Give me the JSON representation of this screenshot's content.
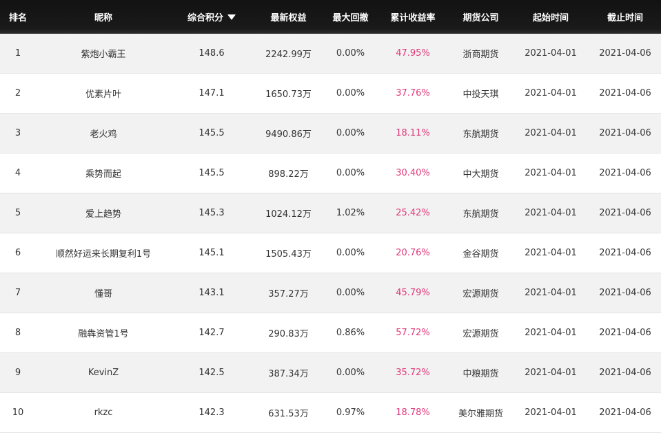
{
  "table": {
    "headers": {
      "rank": "排名",
      "nickname": "昵称",
      "score": "综合积分",
      "equity": "最新权益",
      "drawdown": "最大回撤",
      "yield": "累计收益率",
      "company": "期货公司",
      "start": "起始时间",
      "end": "截止时间"
    },
    "sort_icon": "caret-down-icon",
    "yield_color": "#e2367a",
    "rows": [
      {
        "rank": "1",
        "nickname": "紫炮小霸王",
        "score": "148.6",
        "equity": "2242.99万",
        "drawdown": "0.00%",
        "yield": "47.95%",
        "company": "浙商期货",
        "start": "2021-04-01",
        "end": "2021-04-06"
      },
      {
        "rank": "2",
        "nickname": "优素片叶",
        "score": "147.1",
        "equity": "1650.73万",
        "drawdown": "0.00%",
        "yield": "37.76%",
        "company": "中投天琪",
        "start": "2021-04-01",
        "end": "2021-04-06"
      },
      {
        "rank": "3",
        "nickname": "老火鸡",
        "score": "145.5",
        "equity": "9490.86万",
        "drawdown": "0.00%",
        "yield": "18.11%",
        "company": "东航期货",
        "start": "2021-04-01",
        "end": "2021-04-06"
      },
      {
        "rank": "4",
        "nickname": "乘势而起",
        "score": "145.5",
        "equity": "898.22万",
        "drawdown": "0.00%",
        "yield": "30.40%",
        "company": "中大期货",
        "start": "2021-04-01",
        "end": "2021-04-06"
      },
      {
        "rank": "5",
        "nickname": "爱上趋势",
        "score": "145.3",
        "equity": "1024.12万",
        "drawdown": "1.02%",
        "yield": "25.42%",
        "company": "东航期货",
        "start": "2021-04-01",
        "end": "2021-04-06"
      },
      {
        "rank": "6",
        "nickname": "顺然好运来长期复利1号",
        "score": "145.1",
        "equity": "1505.43万",
        "drawdown": "0.00%",
        "yield": "20.76%",
        "company": "金谷期货",
        "start": "2021-04-01",
        "end": "2021-04-06"
      },
      {
        "rank": "7",
        "nickname": "懂哥",
        "score": "143.1",
        "equity": "357.27万",
        "drawdown": "0.00%",
        "yield": "45.79%",
        "company": "宏源期货",
        "start": "2021-04-01",
        "end": "2021-04-06"
      },
      {
        "rank": "8",
        "nickname": "融犇资管1号",
        "score": "142.7",
        "equity": "290.83万",
        "drawdown": "0.86%",
        "yield": "57.72%",
        "company": "宏源期货",
        "start": "2021-04-01",
        "end": "2021-04-06"
      },
      {
        "rank": "9",
        "nickname": "KevinZ",
        "score": "142.5",
        "equity": "387.34万",
        "drawdown": "0.00%",
        "yield": "35.72%",
        "company": "中粮期货",
        "start": "2021-04-01",
        "end": "2021-04-06"
      },
      {
        "rank": "10",
        "nickname": "rkzc",
        "score": "142.3",
        "equity": "631.53万",
        "drawdown": "0.97%",
        "yield": "18.78%",
        "company": "美尔雅期货",
        "start": "2021-04-01",
        "end": "2021-04-06"
      }
    ]
  }
}
